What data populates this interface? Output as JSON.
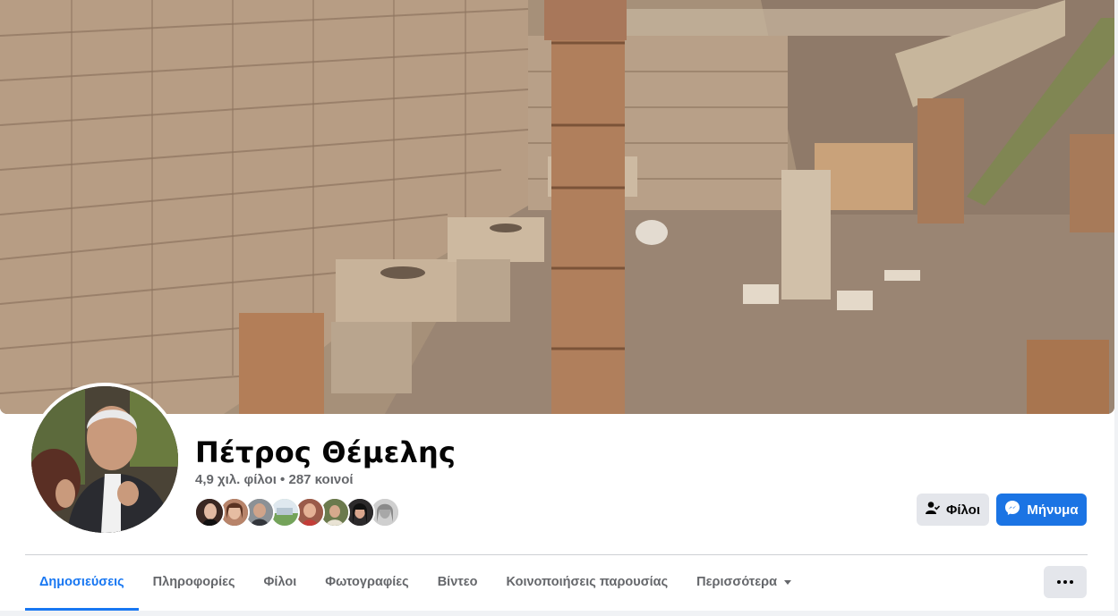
{
  "profile": {
    "name": "Πέτρος Θέμελης",
    "meta": "4,9 χιλ. φίλοι • 287 κοινοί"
  },
  "actions": {
    "friends_label": "Φίλοι",
    "message_label": "Μήνυμα"
  },
  "tabs": [
    {
      "label": "Δημοσιεύσεις",
      "active": true
    },
    {
      "label": "Πληροφορίες"
    },
    {
      "label": "Φίλοι"
    },
    {
      "label": "Φωτογραφίες"
    },
    {
      "label": "Βίντεο"
    },
    {
      "label": "Κοινοποιήσεις παρουσίας"
    },
    {
      "label": "Περισσότερα"
    }
  ],
  "colors": {
    "accent": "#1877f2",
    "message_button": "#1b74e4",
    "secondary_button": "#e4e6eb"
  },
  "icons": {
    "friends": "person-check-icon",
    "message": "messenger-icon",
    "more": "ellipsis-icon",
    "dropdown": "caret-down-icon"
  }
}
